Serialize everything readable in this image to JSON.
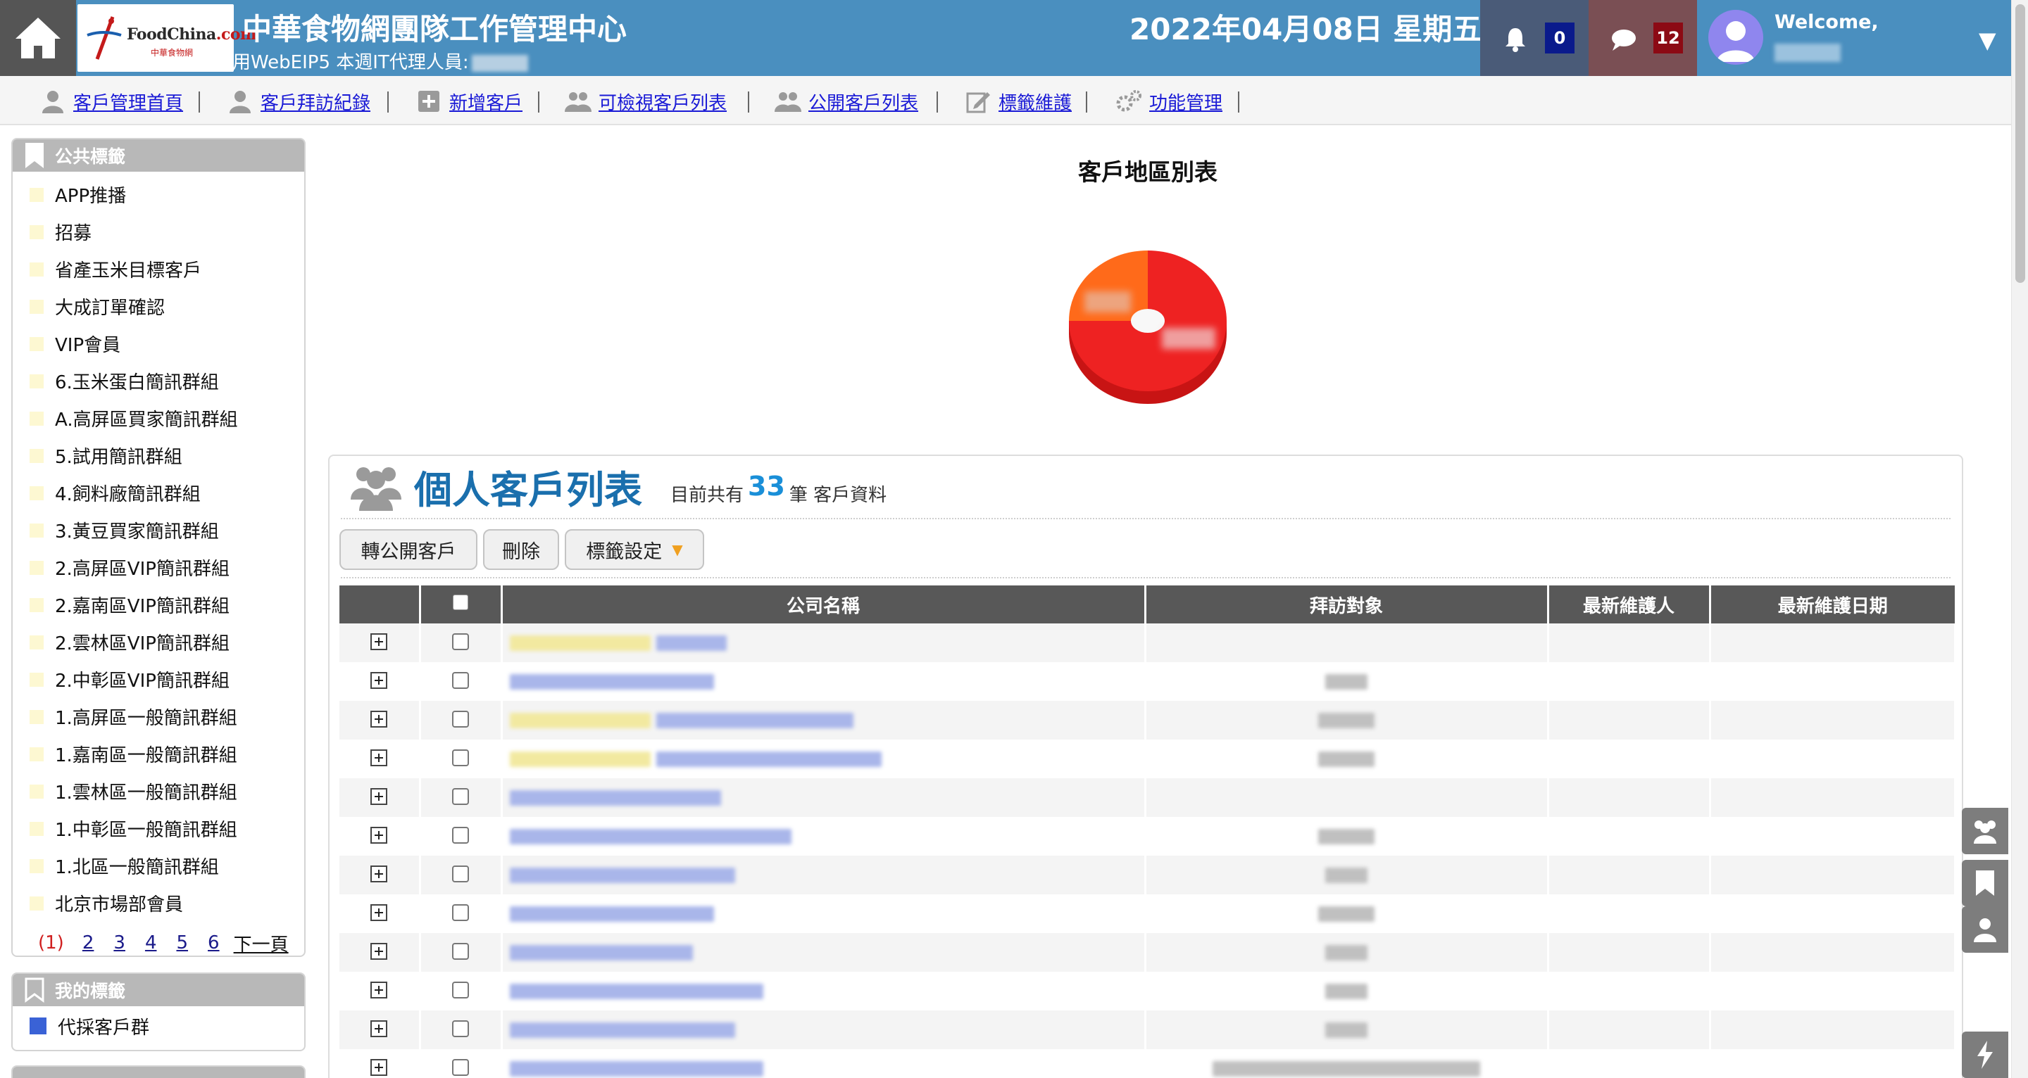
{
  "header": {
    "logo_text_food": "Food",
    "logo_text_china": "China",
    "logo_text_com": ".com",
    "logo_sub": "中華食物網",
    "title": "中華食物網團隊工作管理中心",
    "subline": "用WebEIP5 本週IT代理人員:",
    "date": "2022年04月08日 星期五",
    "notifications_count": "0",
    "messages_count": "12",
    "welcome": "Welcome,",
    "accent_color": "#4a8fbf"
  },
  "nav": {
    "items": [
      {
        "label": "客戶管理首頁",
        "icon": "user-icon"
      },
      {
        "label": "客戶拜訪紀錄",
        "icon": "user-icon"
      },
      {
        "label": "新增客戶",
        "icon": "plus-square-icon"
      },
      {
        "label": "可檢視客戶列表",
        "icon": "users-icon"
      },
      {
        "label": "公開客戶列表",
        "icon": "users-icon"
      },
      {
        "label": "標籤維護",
        "icon": "edit-icon"
      },
      {
        "label": "功能管理",
        "icon": "gears-icon"
      }
    ]
  },
  "sidebar": {
    "public_tags": {
      "title": "公共標籤",
      "items": [
        {
          "label": "APP推播"
        },
        {
          "label": "招募"
        },
        {
          "label": "省產玉米目標客戶"
        },
        {
          "label": "大成訂單確認"
        },
        {
          "label": "VIP會員"
        },
        {
          "label": "6.玉米蛋白簡訊群組"
        },
        {
          "label": "A.高屏區買家簡訊群組"
        },
        {
          "label": "5.試用簡訊群組"
        },
        {
          "label": "4.飼料廠簡訊群組"
        },
        {
          "label": "3.黃豆買家簡訊群組"
        },
        {
          "label": "2.高屏區VIP簡訊群組"
        },
        {
          "label": "2.嘉南區VIP簡訊群組"
        },
        {
          "label": "2.雲林區VIP簡訊群組"
        },
        {
          "label": "2.中彰區VIP簡訊群組"
        },
        {
          "label": "1.高屏區一般簡訊群組"
        },
        {
          "label": "1.嘉南區一般簡訊群組"
        },
        {
          "label": "1.雲林區一般簡訊群組"
        },
        {
          "label": "1.中彰區一般簡訊群組"
        },
        {
          "label": "1.北區一般簡訊群組"
        },
        {
          "label": "北京市場部會員"
        }
      ],
      "pager": {
        "current": "(1)",
        "pages": [
          "2",
          "3",
          "4",
          "5",
          "6"
        ],
        "next": "下一頁"
      }
    },
    "my_tags": {
      "title": "我的標籤",
      "items": [
        {
          "label": "代採客戶群",
          "color": "#3a62d6"
        }
      ]
    }
  },
  "chart": {
    "title": "客戶地區別表"
  },
  "chart_data": {
    "type": "pie",
    "title": "客戶地區別表",
    "slices": [
      {
        "name": "",
        "value": 75,
        "color": "#ee2222"
      },
      {
        "name": "",
        "value": 25,
        "color": "#ff6a1a"
      }
    ]
  },
  "customer_list": {
    "title": "個人客戶列表",
    "count_prefix": "目前共有",
    "count": "33",
    "count_suffix": "筆 客戶資料",
    "buttons": {
      "to_public": "轉公開客戶",
      "delete": "刪除",
      "tag_settings": "標籤設定"
    },
    "columns": {
      "company": "公司名稱",
      "visit_target": "拜訪對象",
      "maintainer": "最新維護人",
      "maint_date": "最新維護日期"
    },
    "rows": [
      {
        "highlight": true
      },
      {
        "highlight": false
      },
      {
        "highlight": true
      },
      {
        "highlight": true
      },
      {
        "highlight": false
      },
      {
        "highlight": false
      },
      {
        "highlight": false
      },
      {
        "highlight": false
      },
      {
        "highlight": false
      },
      {
        "highlight": false
      },
      {
        "highlight": false
      },
      {
        "highlight": false
      }
    ]
  },
  "dock": {
    "items": [
      "users-icon",
      "bookmark-icon",
      "user-icon",
      "bolt-icon"
    ]
  }
}
